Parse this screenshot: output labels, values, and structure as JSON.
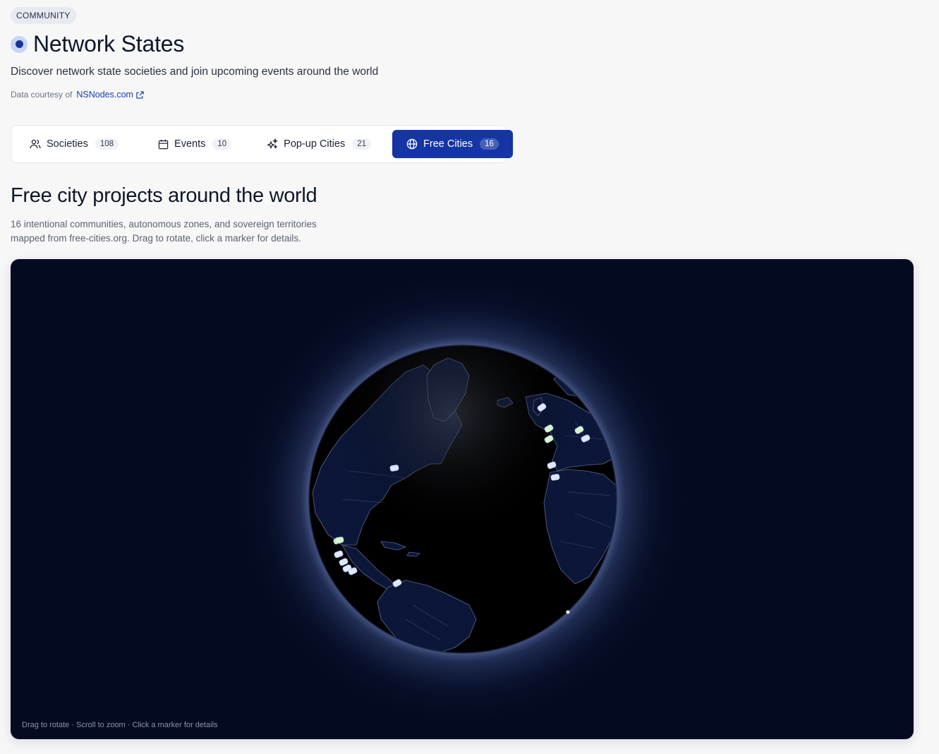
{
  "header": {
    "badge": "COMMUNITY",
    "title": "Network States",
    "subtitle": "Discover network state societies and join upcoming events around the world",
    "courtesy_prefix": "Data courtesy of",
    "courtesy_link": "NSNodes.com"
  },
  "tabs": [
    {
      "label": "Societies",
      "count": "108",
      "icon": "users-icon",
      "active": false
    },
    {
      "label": "Events",
      "count": "10",
      "icon": "calendar-icon",
      "active": false
    },
    {
      "label": "Pop-up Cities",
      "count": "21",
      "icon": "sparkles-icon",
      "active": false
    },
    {
      "label": "Free Cities",
      "count": "16",
      "icon": "globe-icon",
      "active": true
    }
  ],
  "section": {
    "title": "Free city projects around the world",
    "description": "16 intentional communities, autonomous zones, and sovereign territories mapped from free-cities.org. Drag to rotate, click a marker for details."
  },
  "globe": {
    "hint": "Drag to rotate · Scroll to zoom · Click a marker for details",
    "marker_count": 16,
    "colors": {
      "panel": "#040b21",
      "ocean": "#000000",
      "land": "#0b1638",
      "border": "#5d6a92",
      "marker": "#dfe8ff",
      "marker_alt": "#d8f5c8"
    }
  },
  "colors": {
    "accent": "#1435a3",
    "background": "#f7f7f8",
    "link": "#1a3db0"
  }
}
